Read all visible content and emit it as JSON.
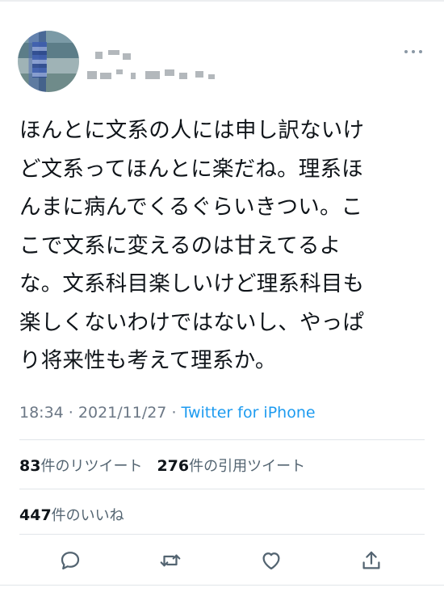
{
  "tweet": {
    "text": "ほんとに文系の人には申し訳ないけ\nど文系ってほんとに楽だね。理系ほ\nんまに病んでくるぐらいきつい。こ\nこで文系に変えるのは甘えてるよ\nな。文系科目楽しいけど理系科目も\n楽しくないわけではないし、やっぱ\nり将来性も考えて理系か。",
    "time": "18:34",
    "date": "2021/11/27",
    "separator": " · ",
    "source": "Twitter for iPhone"
  },
  "stats": {
    "retweets_count": "83",
    "retweets_label": "件のリツイート",
    "quotes_count": "276",
    "quotes_label": "件の引用ツイート",
    "likes_count": "447",
    "likes_label": "件のいいね"
  },
  "icons": {
    "more": "more-icon",
    "reply": "reply-icon",
    "retweet": "retweet-icon",
    "like": "heart-icon",
    "share": "share-icon"
  }
}
